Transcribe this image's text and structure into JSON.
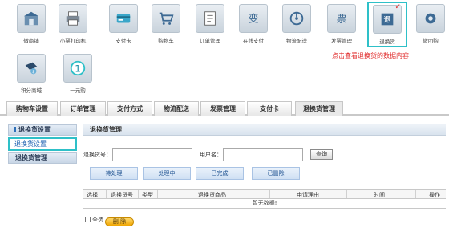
{
  "toolbar": {
    "row1": [
      {
        "label": "微商铺",
        "icon": "shop-icon"
      },
      {
        "label": "小票打印机",
        "icon": "printer-icon"
      },
      {
        "label": "支付卡",
        "icon": "payment-card-icon"
      },
      {
        "label": "购物车",
        "icon": "shopping-cart-icon"
      },
      {
        "label": "订单管理",
        "icon": "order-management-icon"
      },
      {
        "label": "在线支付",
        "icon": "online-payment-icon"
      },
      {
        "label": "物流配送",
        "icon": "logistics-icon"
      },
      {
        "label": "发票管理",
        "icon": "invoice-icon"
      },
      {
        "label": "退换货",
        "icon": "return-exchange-icon"
      },
      {
        "label": "微团购",
        "icon": "group-buy-icon"
      }
    ],
    "row2": [
      {
        "label": "积分商城",
        "icon": "points-mall-icon"
      },
      {
        "label": "一元购",
        "icon": "one-yuan-buy-icon"
      }
    ],
    "active_checkmark": "✓"
  },
  "hint_text": "点击查看退换货的数据内容",
  "tabs": [
    "购物车设置",
    "订单管理",
    "支付方式",
    "物流配送",
    "发票管理",
    "支付卡",
    "退换货管理"
  ],
  "left_menu": {
    "section": "退换货设置",
    "item": "退换货设置",
    "sub": "退换货管理"
  },
  "panel": {
    "title": "退换货管理",
    "search": {
      "order_label": "退换货号：",
      "user_label": "用户名：",
      "query_button": "查询"
    },
    "filters": [
      "待处理",
      "处理中",
      "已完成",
      "已删除"
    ],
    "columns": [
      "选择",
      "退换货号",
      "类型",
      "退换货商品",
      "申请理由",
      "时间",
      "操作"
    ],
    "empty_text": "暂无数据!",
    "select_all_label": "全选",
    "delete_button": "删 除"
  },
  "colors": {
    "accent_outline": "#2ec0c8",
    "hint_red": "#e02a2a",
    "link_blue": "#1b5fb0"
  }
}
